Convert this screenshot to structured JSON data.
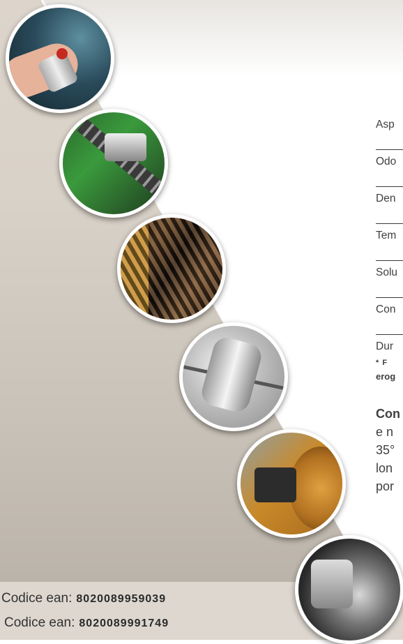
{
  "spec_table": {
    "rows": [
      "Asp",
      "Odo",
      "Den",
      "Tem",
      "Solu",
      "Con",
      "Dur"
    ]
  },
  "note": {
    "line1": "* F",
    "line2": "erog"
  },
  "description": {
    "lines": [
      "Con",
      "e n",
      "35°",
      "lon",
      "por"
    ]
  },
  "codes": [
    {
      "label": "Codice ean:",
      "value": "8020089959039"
    },
    {
      "label": "Codice ean:",
      "value": "8020089991749"
    }
  ],
  "photos": [
    "spray-can-photo",
    "chain-photo",
    "steel-cable-photo",
    "clamp-photo",
    "gear-machinery-photo",
    "brake-disc-photo"
  ]
}
